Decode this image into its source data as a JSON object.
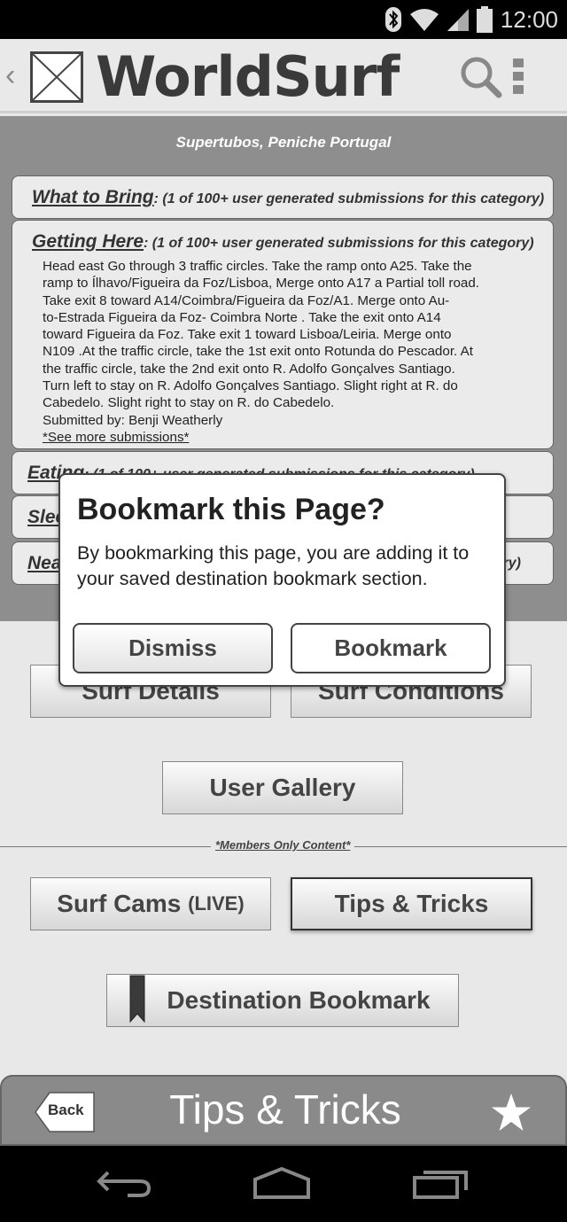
{
  "status_bar": {
    "time": "12:00",
    "icons": [
      "bluetooth-icon",
      "wifi-icon",
      "signal-icon",
      "battery-icon"
    ]
  },
  "header": {
    "title": "WorldSurf",
    "back_icon": "chevron-left-icon",
    "logo": "image-placeholder-icon",
    "actions": [
      "search-icon",
      "overflow-menu-icon"
    ]
  },
  "content": {
    "location": "Supertubos, Peniche Portugal",
    "categories": [
      {
        "name": "What to Bring",
        "meta": ": (1 of 100+ user generated submissions for this category)"
      },
      {
        "name": "Getting Here",
        "meta": ": (1 of 100+ user generated submissions for this category)",
        "lines": [
          "Head east Go through 3 traffic circles. Take the ramp onto A25. Take the",
          "ramp to Ílhavo/Figueira da Foz/Lisboa, Merge onto A17 a Partial toll road.",
          "Take exit 8 toward A14/Coimbra/Figueira da Foz/A1. Merge onto Au-",
          "to-Estrada Figueira da Foz- Coimbra Norte . Take the exit onto A14",
          "toward Figueira da Foz. Take exit 1 toward Lisboa/Leiria. Merge onto",
          "N109 .At the traffic circle, take the 1st exit onto Rotunda do Pescador. At",
          "the traffic circle, take the 2nd exit onto R. Adolfo Gonçalves Santiago.",
          "Turn left to stay on R. Adolfo Gonçalves Santiago. Slight right at R. do",
          "Cabedelo. Slight right to stay on R. do Cabedelo."
        ],
        "submitted_by": "Submitted by: Benji Weatherly",
        "see_more": "*See more submissions*"
      },
      {
        "name": "Eating",
        "meta": ": (1 of 100+ user generated submissions for this category)"
      },
      {
        "name": "Slee",
        "meta": ""
      },
      {
        "name": "Nea",
        "meta": "ry)"
      }
    ]
  },
  "buttons": {
    "surf_details": "Surf Details",
    "surf_conditions": "Surf Conditions",
    "user_gallery": "User Gallery",
    "members_only": "*Members Only Content*",
    "surf_cams": "Surf Cams",
    "surf_cams_live": "(LIVE)",
    "tips_tricks": "Tips & Tricks",
    "destination_bookmark": "Destination Bookmark"
  },
  "bottom_bar": {
    "back": "Back",
    "title": "Tips & Tricks",
    "star_icon": "star-icon"
  },
  "dialog": {
    "title": "Bookmark this Page?",
    "message": "By bookmarking this page, you are adding it to your saved destination bookmark section.",
    "dismiss": "Dismiss",
    "bookmark": "Bookmark"
  },
  "nav_bar": {
    "icons": [
      "back-nav-icon",
      "home-nav-icon",
      "recents-nav-icon"
    ]
  },
  "colors": {
    "panel_gray": "#8e8e8e",
    "background": "#e8e8e8",
    "bar_black": "#000000"
  }
}
